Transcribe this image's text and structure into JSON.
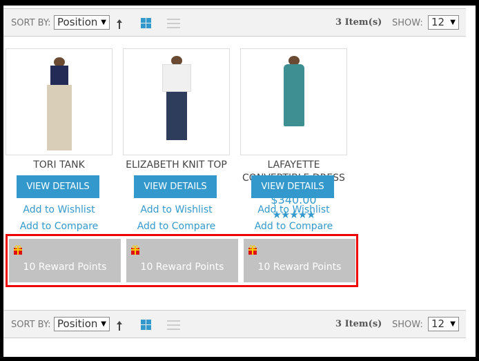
{
  "toolbar": {
    "sort_label": "SORT BY:",
    "sort_value": "Position",
    "count": "3 Item(s)",
    "show_label": "SHOW:",
    "show_value": "12",
    "sort_direction_icon": "arrow-up-icon",
    "grid_icon": "grid-view-icon",
    "list_icon": "list-view-icon"
  },
  "products": [
    {
      "name": "TORI TANK",
      "view": "VIEW DETAILS",
      "wishlist": "Add to Wishlist",
      "compare": "Add to Compare",
      "reward": "10 Reward Points"
    },
    {
      "name": "ELIZABETH KNIT TOP",
      "view": "VIEW DETAILS",
      "wishlist": "Add to Wishlist",
      "compare": "Add to Compare",
      "reward": "10 Reward Points"
    },
    {
      "name": "LAFAYETTE CONVERTIBLE DRESS",
      "price": "$340.00",
      "rating": "★★★★★",
      "view": "VIEW DETAILS",
      "wishlist": "Add to Wishlist",
      "compare": "Add to Compare",
      "reward": "10 Reward Points"
    }
  ],
  "colors": {
    "accent": "#3399cc",
    "highlight": "#ee0000",
    "reward_bg": "#c2c2c2"
  }
}
